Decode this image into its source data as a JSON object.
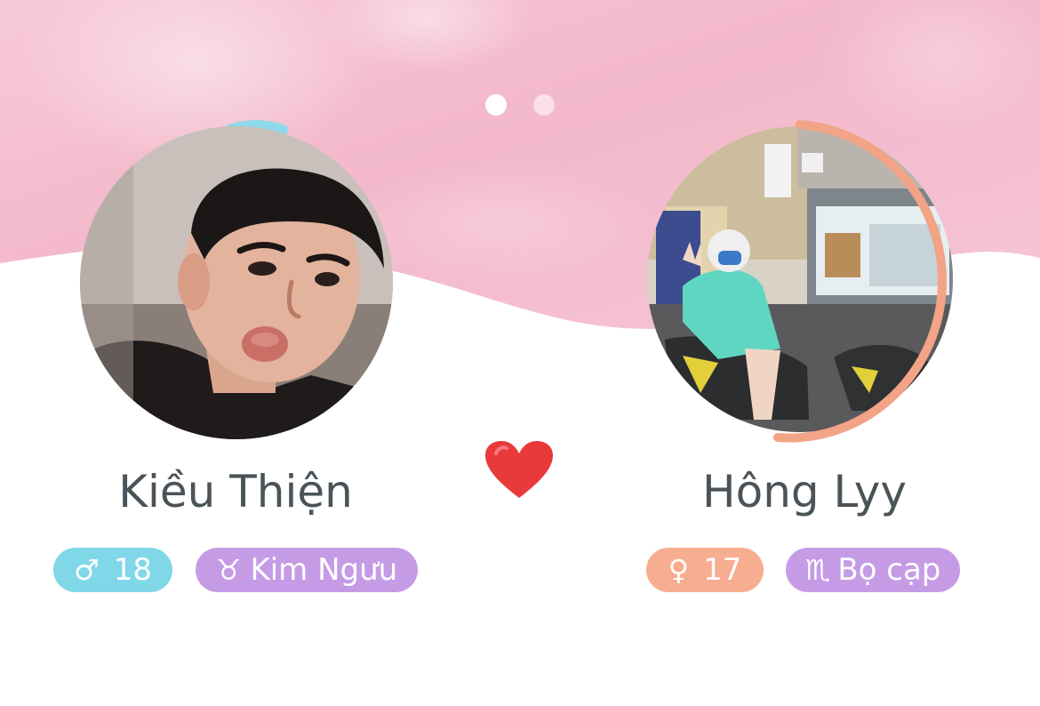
{
  "carousel": {
    "page_count": 2,
    "active_index": 0
  },
  "profiles": [
    {
      "name": "Kiều Thiện",
      "gender_symbol": "♂",
      "age": "18",
      "zodiac_symbol": "♉",
      "zodiac": "Kim Ngưu",
      "gender_color": "#7fd7e8",
      "ring_color": "#8fd9ea"
    },
    {
      "name": "Hông Lyy",
      "gender_symbol": "♀",
      "age": "17",
      "zodiac_symbol": "♏",
      "zodiac": "Bọ cạp",
      "gender_color": "#f7ad8f",
      "ring_color": "#f3a386"
    }
  ],
  "match": {
    "icon": "heart-icon",
    "color": "#e8393b"
  },
  "zodiac_color": "#c59be6"
}
